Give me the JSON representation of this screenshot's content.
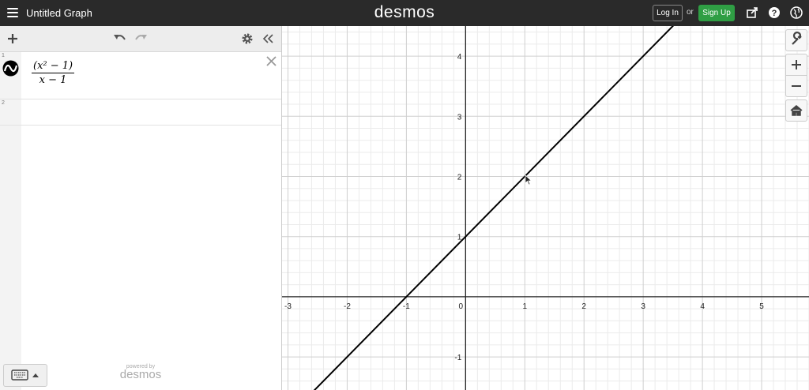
{
  "header": {
    "title": "Untitled Graph",
    "logo": "desmos",
    "login_label": "Log In",
    "or_label": "or",
    "signup_label": "Sign Up",
    "signup_color": "#2f9e44",
    "icons": [
      "share-icon",
      "help-icon",
      "globe-icon"
    ]
  },
  "toolbar": {
    "icons": [
      "add-icon",
      "undo-icon",
      "redo-icon",
      "settings-icon",
      "collapse-panel-icon"
    ]
  },
  "expressions": [
    {
      "index": "1",
      "numerator": "(x² − 1)",
      "denominator": "x − 1",
      "color": "#000000"
    },
    {
      "index": "2",
      "numerator": "",
      "denominator": ""
    }
  ],
  "footer": {
    "powered_by": "powered by",
    "brand": "desmos"
  },
  "graph_tools": [
    "wrench-icon",
    "zoom-in-icon",
    "zoom-out-icon",
    "home-icon"
  ],
  "chart_data": {
    "type": "line",
    "xlim": [
      -3.1,
      5.8
    ],
    "ylim": [
      -1.55,
      4.5
    ],
    "x_ticks": [
      "-3",
      "-2",
      "-1",
      "0",
      "1",
      "2",
      "3",
      "4",
      "5"
    ],
    "y_ticks": [
      "-1",
      "1",
      "2",
      "3",
      "4"
    ],
    "grid": true,
    "series": [
      {
        "x": [
          -2.6,
          3.55
        ],
        "y": [
          -1.6,
          4.55
        ],
        "color": "#000000"
      }
    ]
  }
}
